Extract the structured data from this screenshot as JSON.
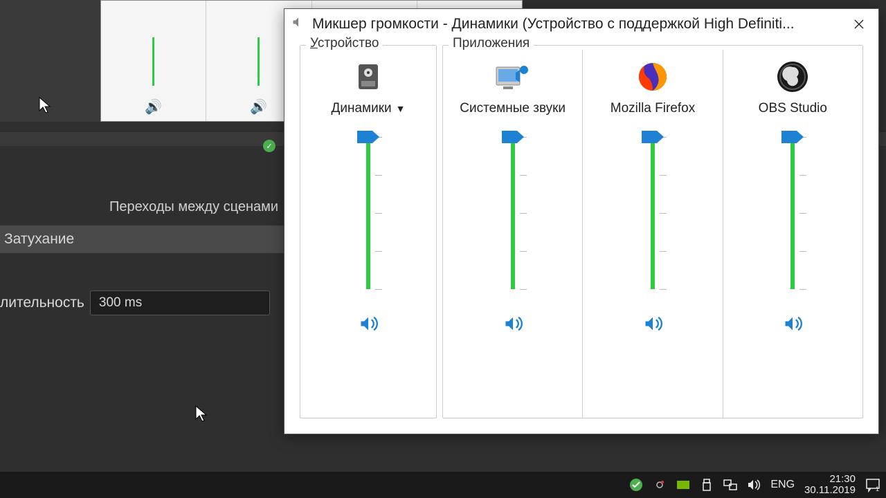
{
  "obs": {
    "transitions_header": "Переходы между сценами",
    "fade_label": "Затухание",
    "duration_label": "лительность",
    "duration_value": "300 ms"
  },
  "mixer": {
    "title": "Микшер громкости - Динамики (Устройство с поддержкой High Definiti...",
    "device_group_label": "Устройство",
    "apps_group_label": "Приложения",
    "device_label": "Динамики",
    "columns": [
      {
        "name": "Динамики",
        "volume": 100,
        "icon": "speaker-device"
      },
      {
        "name": "Системные звуки",
        "volume": 100,
        "icon": "system-sounds"
      },
      {
        "name": "Mozilla Firefox",
        "volume": 100,
        "icon": "firefox"
      },
      {
        "name": "OBS Studio",
        "volume": 100,
        "icon": "obs"
      }
    ]
  },
  "taskbar": {
    "language": "ENG",
    "time": "21:30",
    "date": "30.11.2019",
    "notification_count": "1"
  }
}
